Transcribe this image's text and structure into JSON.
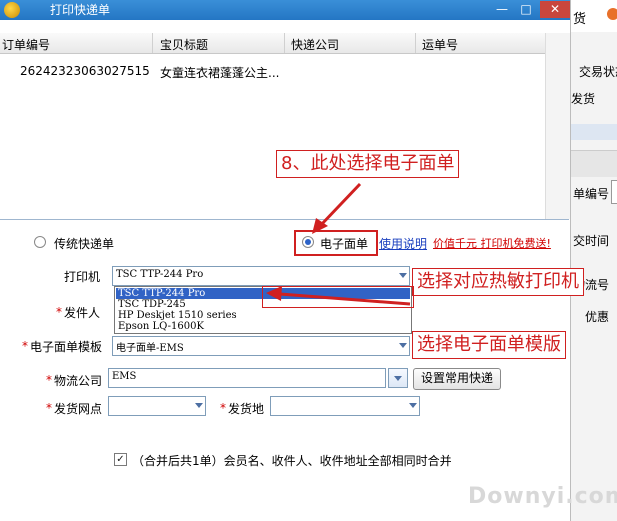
{
  "window": {
    "title": "打印快递单",
    "minimize": "—",
    "maximize": "□",
    "close": "✕"
  },
  "table": {
    "headers": [
      "订单编号",
      "宝贝标题",
      "快递公司",
      "运单号"
    ],
    "rows": [
      [
        "262423230630275​15",
        "女童连衣裙蓬蓬公主...",
        "",
        ""
      ]
    ]
  },
  "options": {
    "radio_traditional": "传统快递单",
    "radio_electronic": "电子面单",
    "help_link": "使用说明",
    "promo_link": "价值千元 打印机免费送!"
  },
  "form": {
    "printer_label": "打印机",
    "printer_value": "TSC TTP-244 Pro",
    "printer_options": [
      "TSC TTP-244 Pro",
      "TSC TDP-245",
      "HP Deskjet 1510 series",
      "Epson LQ-1600K"
    ],
    "sender_label": "发件人",
    "template_label": "电子面单模板",
    "template_value": "电子面单-EMS",
    "carrier_label": "物流公司",
    "carrier_value": "EMS",
    "carrier_button": "设置常用快递",
    "branch_label": "发货网点",
    "origin_label": "发货地",
    "required_mark": "*",
    "merge_label": "（合并后共1单）会员名、收件人、收件地址全部相同时合并"
  },
  "annotations": {
    "step8": "8、此处选择电子面单",
    "choose_printer": "选择对应热敏打印机",
    "choose_template": "选择电子面单模版"
  },
  "background_app": {
    "tab": "货",
    "items": [
      "交易状态",
      "发货",
      "单编号",
      "交时间",
      "物流号",
      "优惠"
    ]
  },
  "watermark": "Downyi.com",
  "colors": {
    "title_bar": "#2476c4",
    "annotation": "#d02020",
    "selection": "#3163c5"
  }
}
